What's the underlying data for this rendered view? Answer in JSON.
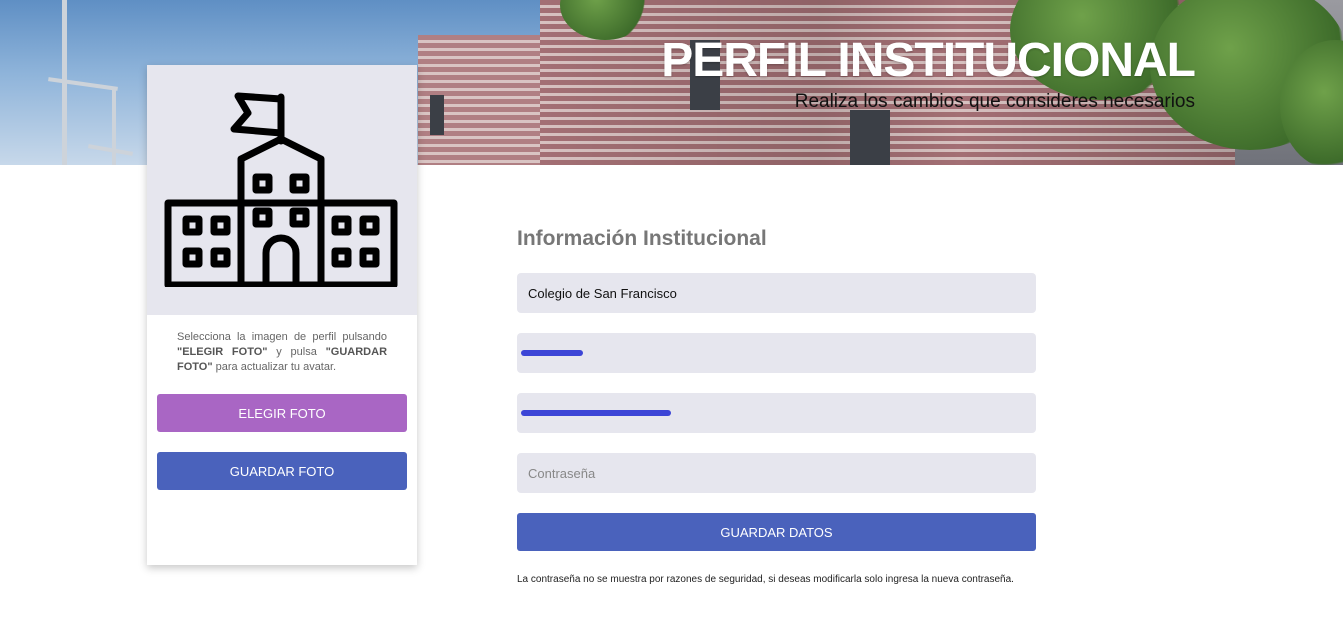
{
  "header": {
    "title": "PERFIL INSTITUCIONAL",
    "subtitle": "Realiza los cambios que consideres necesarios"
  },
  "profile_card": {
    "avatar_icon": "school-building-icon",
    "instructions": {
      "part1": "Selecciona la imagen de perfil pulsando ",
      "bold1": "\"ELEGIR FOTO\"",
      "part2": " y pulsa ",
      "bold2": "\"GUARDAR FOTO\"",
      "part3": " para actualizar tu avatar."
    },
    "choose_photo_label": "ELEGIR FOTO",
    "save_photo_label": "GUARDAR FOTO"
  },
  "form": {
    "title": "Información Institucional",
    "institution_name": "Colegio de San Francisco",
    "password_placeholder": "Contraseña",
    "save_data_label": "GUARDAR DATOS",
    "note": "La contraseña no se muestra por razones de seguridad, si deseas modificarla solo ingresa la nueva contraseña."
  },
  "colors": {
    "choose_button": "#a966c4",
    "save_button": "#4a62bc",
    "field_background": "#e6e6ee"
  }
}
